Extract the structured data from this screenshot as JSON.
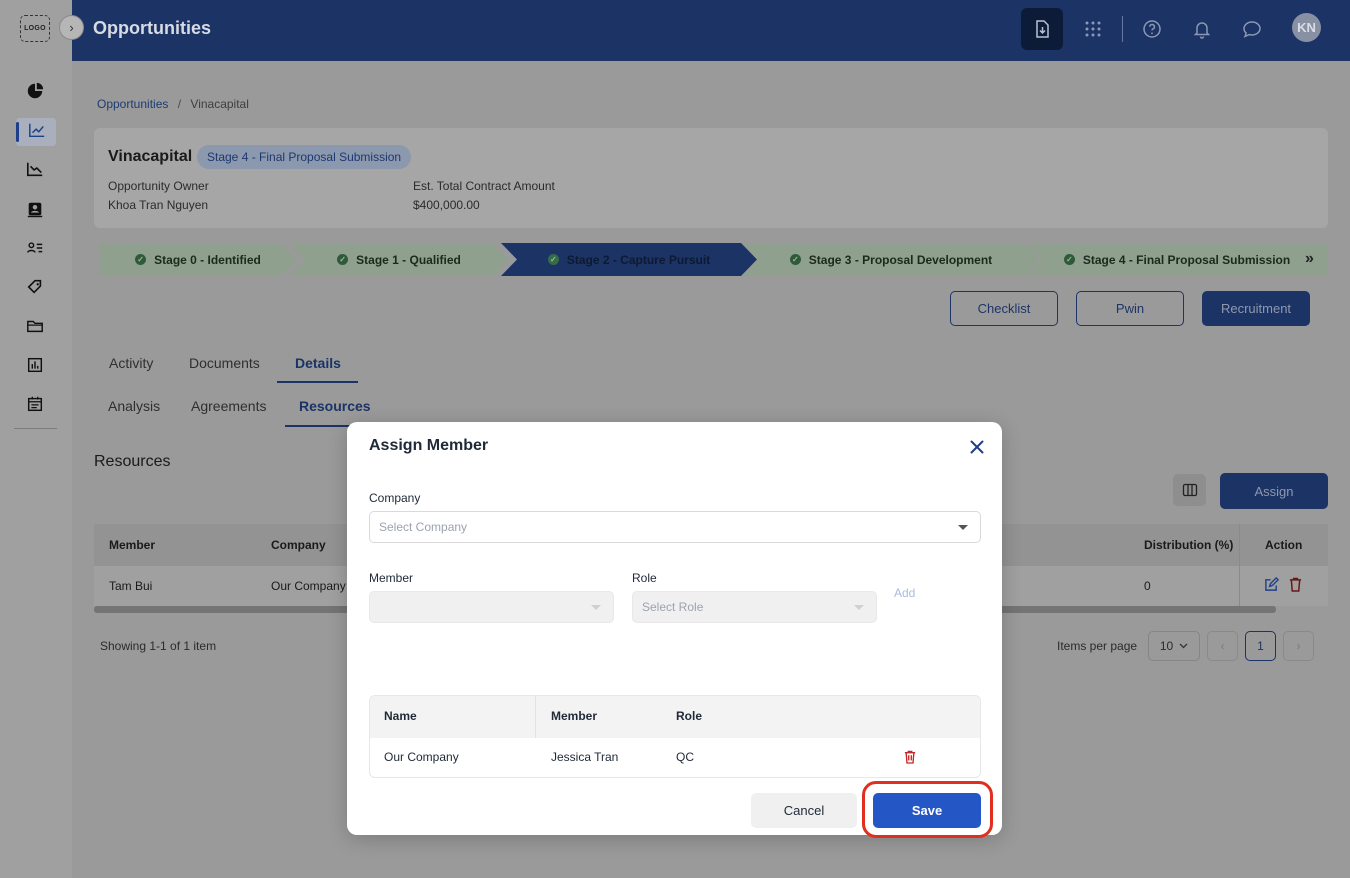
{
  "app": {
    "logo_text": "LOGO",
    "title": "Opportunities",
    "user_initials": "KN"
  },
  "sidebar": {
    "items": [
      {
        "icon": "pie-chart-icon"
      },
      {
        "icon": "line-chart-icon",
        "active": true
      },
      {
        "icon": "area-chart-icon"
      },
      {
        "icon": "contact-card-icon"
      },
      {
        "icon": "people-list-icon"
      },
      {
        "icon": "tag-icon"
      },
      {
        "icon": "folder-icon"
      },
      {
        "icon": "bar-report-icon"
      },
      {
        "icon": "calendar-list-icon"
      }
    ]
  },
  "header": {
    "icons": [
      "download-icon",
      "apps-grid-icon",
      "help-icon",
      "bell-icon",
      "chat-icon"
    ]
  },
  "breadcrumb": {
    "parent": "Opportunities",
    "separator": "/",
    "current": "Vinacapital"
  },
  "opportunity": {
    "name": "Vinacapital",
    "stage_badge": "Stage 4 - Final Proposal Submission",
    "owner_label": "Opportunity Owner",
    "owner_value": "Khoa Tran Nguyen",
    "amount_label": "Est. Total Contract Amount",
    "amount_value": "$400,000.00"
  },
  "stages": [
    {
      "label": "Stage 0 - Identified",
      "state": "done"
    },
    {
      "label": "Stage 1 - Qualified",
      "state": "done"
    },
    {
      "label": "Stage 2 - Capture Pursuit",
      "state": "active"
    },
    {
      "label": "Stage 3 - Proposal Development",
      "state": "done"
    },
    {
      "label": "Stage 4 - Final Proposal Submission",
      "state": "done"
    }
  ],
  "stage_more": "»",
  "actions": {
    "checklist": "Checklist",
    "pwin": "Pwin",
    "recruitment": "Recruitment"
  },
  "tabs_main": [
    "Activity",
    "Documents",
    "Details"
  ],
  "tabs_sub": [
    "Analysis",
    "Agreements",
    "Resources"
  ],
  "resources": {
    "title": "Resources",
    "assign_label": "Assign",
    "columns": {
      "member": "Member",
      "company": "Company",
      "distribution": "Distribution (%)",
      "action": "Action"
    },
    "row": {
      "member": "Tam Bui",
      "company": "Our Company",
      "distribution": "0"
    },
    "showing": "Showing 1-1 of 1 item",
    "items_per_page_label": "Items per page",
    "items_per_page": "10",
    "current_page": "1"
  },
  "modal": {
    "title": "Assign Member",
    "company_label": "Company",
    "company_placeholder": "Select Company",
    "member_label": "Member",
    "role_label": "Role",
    "role_placeholder": "Select Role",
    "add_label": "Add",
    "table": {
      "headers": [
        "Name",
        "Member",
        "Role"
      ],
      "rows": [
        {
          "name": "Our Company",
          "member": "Jessica Tran",
          "role": "QC"
        }
      ]
    },
    "cancel_label": "Cancel",
    "save_label": "Save"
  },
  "colors": {
    "header_bg": "#1b3365",
    "primary": "#2456c5",
    "highlight": "#e02f1f",
    "danger": "#c62828"
  }
}
